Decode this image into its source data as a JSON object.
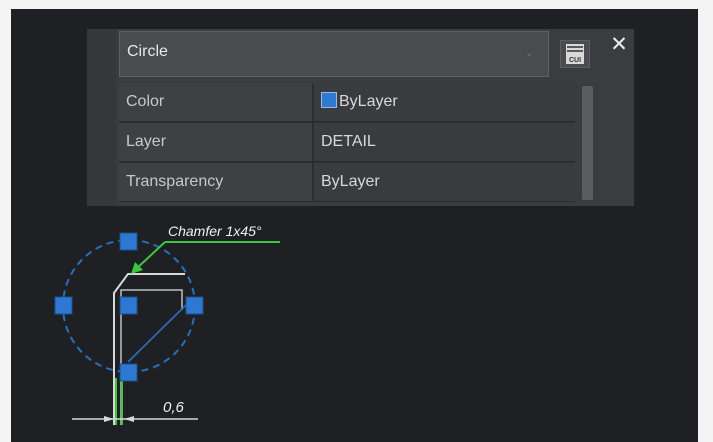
{
  "quick_properties": {
    "object_type": "Circle",
    "cui_button_icon": "cui-icon",
    "cui_button_label": "CUI",
    "close_label": "✕",
    "rows": [
      {
        "name": "Color",
        "value": "ByLayer",
        "swatch_color": "#2f7ad1"
      },
      {
        "name": "Layer",
        "value": "DETAIL"
      },
      {
        "name": "Transparency",
        "value": "ByLayer"
      }
    ]
  },
  "drawing": {
    "chamfer_label": "Chamfer 1x45°",
    "dimension_value": "0,6"
  },
  "colors": {
    "canvas_background": "#1f2023",
    "grip": "#2e78d2",
    "leader": "#3cc742",
    "circle_dashed": "#2b6eb8"
  }
}
